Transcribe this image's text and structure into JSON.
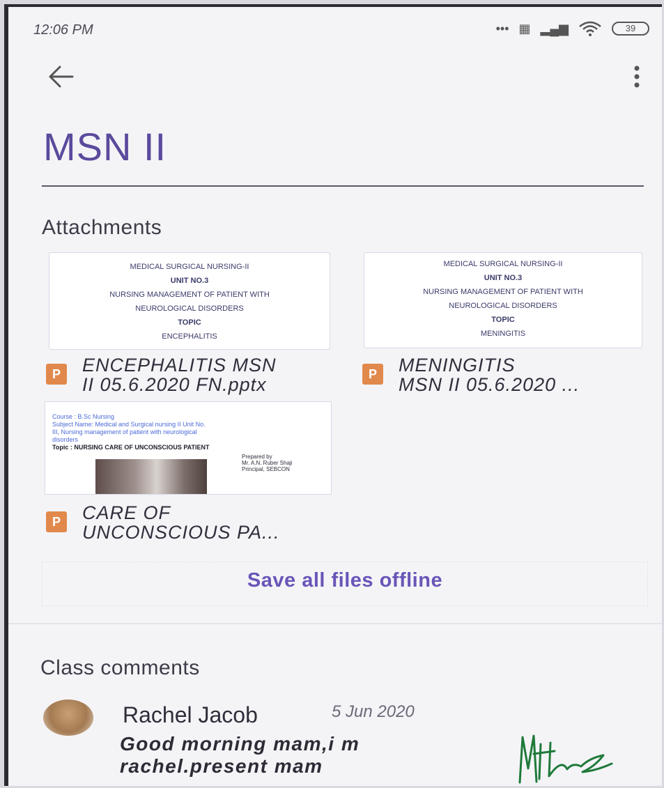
{
  "status_bar": {
    "time": "12:06 PM",
    "battery": "39"
  },
  "app_bar": {
    "back_icon": "arrow-left-icon",
    "menu_icon": "more-vert-icon"
  },
  "page": {
    "title": "MSN II"
  },
  "attachments": {
    "heading": "Attachments",
    "files": [
      {
        "name_line1": "ENCEPHALITIS MSN",
        "name_line2": "II 05.6.2020 FN.pptx",
        "badge": "P",
        "thumb": {
          "line1": "MEDICAL SURGICAL NURSING-II",
          "line2": "UNIT NO.3",
          "line3": "NURSING MANAGEMENT OF PATIENT WITH",
          "line4": "NEUROLOGICAL DISORDERS",
          "line5": "TOPIC",
          "line6": "ENCEPHALITIS"
        }
      },
      {
        "name_line1": "MENINGITIS",
        "name_line2": "MSN II 05.6.2020 ...",
        "badge": "P",
        "thumb": {
          "line1": "MEDICAL SURGICAL NURSING-II",
          "line2": "UNIT NO.3",
          "line3": "NURSING MANAGEMENT OF PATIENT WITH",
          "line4": "NEUROLOGICAL DISORDERS",
          "line5": "TOPIC",
          "line6": "MENINGITIS"
        }
      },
      {
        "name_line1": "CARE OF",
        "name_line2": "UNCONSCIOUS PA...",
        "badge": "P",
        "thumb": {
          "line1": "Course : B.Sc Nursing",
          "line2": "Subject Name: Medical and Surgical nursing II Unit No.",
          "line3": "III, Nursing management of patient with neurological",
          "line4": "disorders",
          "line5": "Topic : NURSING CARE OF UNCONSCIOUS PATIENT",
          "line6": "Prepared by",
          "line7": "Mr. A.N. Ruber Shaji",
          "line8": "Principal, SEBCON"
        }
      }
    ],
    "save_button": "Save all files offline"
  },
  "comments": {
    "heading": "Class comments",
    "items": [
      {
        "author": "Rachel Jacob",
        "date": "5 Jun 2020",
        "text_line1": "Good morning mam,i m",
        "text_line2": "rachel.present mam"
      }
    ]
  },
  "colors": {
    "accent": "#5b4a9c",
    "button": "#6a55b8",
    "badge": "#e1894c"
  }
}
